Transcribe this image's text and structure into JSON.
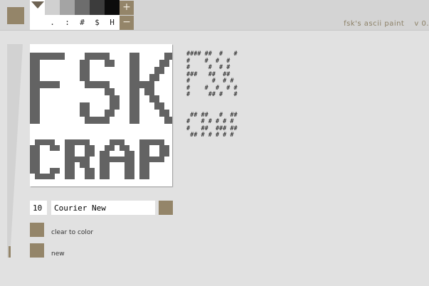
{
  "palette": {
    "colors": [
      "#ffffff",
      "#d0d0d0",
      "#a4a4a4",
      "#6d6d6d",
      "#3c3c3c",
      "#0c0c0c"
    ],
    "chars": [
      "",
      ".",
      ":",
      "#",
      "$",
      "H"
    ]
  },
  "toolbar": {
    "zoom_in_label": "+",
    "zoom_out_label": "−"
  },
  "header": {
    "title": "fsk's ascii paint",
    "version": "v 0."
  },
  "ascii_preview": "#### ##  #   #\n#    #  #  #\n#     #  # #\n###   ##  ##\n#      #  # #\n#    #  #  # #\n#     ## #   #\n\n\n ## ##   #  ##\n#   # # # # #\n#   ##  ### ##\n ## # # # # #",
  "controls": {
    "font_size": "10",
    "font_name": "Courier New",
    "clear_label": "clear to color",
    "new_label": "new"
  },
  "colors": {
    "accent": "#948569",
    "canvas_ink": "#636363"
  }
}
